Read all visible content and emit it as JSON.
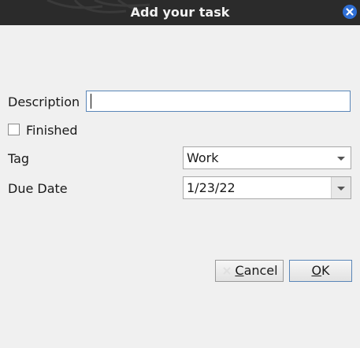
{
  "window": {
    "title": "Add your task"
  },
  "form": {
    "description_label": "Description",
    "description_value": "",
    "finished_label": "Finished",
    "finished_checked": false,
    "tag_label": "Tag",
    "tag_value": "Work",
    "due_date_label": "Due Date",
    "due_date_value": "1/23/22"
  },
  "buttons": {
    "cancel_mnemonic": "C",
    "cancel_rest": "ancel",
    "ok_mnemonic": "O",
    "ok_rest": "K"
  },
  "icons": {
    "close": "close-icon",
    "dropdown": "chevron-down-icon",
    "cancel": "cancel-x-icon"
  },
  "colors": {
    "titlebar": "#2b2b2b",
    "close_button": "#2f6fd6",
    "focus_border": "#5a86b8",
    "background": "#f0f0f0"
  }
}
